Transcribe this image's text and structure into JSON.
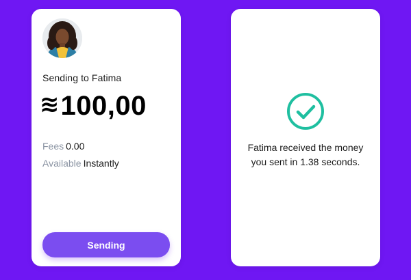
{
  "send_card": {
    "recipient_text": "Sending to Fatima",
    "currency_symbol": "≋",
    "amount": "100,00",
    "fees_label": "Fees",
    "fees_value": "0.00",
    "available_label": "Available",
    "available_value": "Instantly",
    "button_label": "Sending"
  },
  "confirmation_card": {
    "message": "Fatima received the money you sent in 1.38 seconds.",
    "icon": "check-circle-icon"
  },
  "colors": {
    "background": "#6f17f3",
    "button": "#7b4df0",
    "success": "#1fbfa0"
  }
}
